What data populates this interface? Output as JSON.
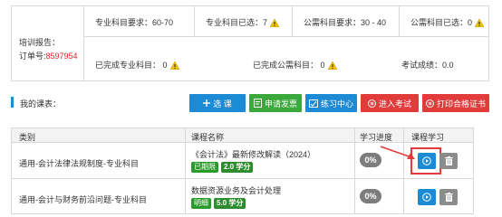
{
  "report": {
    "title": "培训报告：",
    "order_label": "订单号:",
    "order_number": "8597954",
    "professional_required": "专业科目要求：60-70",
    "professional_selected": "专业科目已选：7",
    "public_required": "公需科目要求：30 - 40",
    "public_selected": "公需科目已选：0",
    "professional_completed": "已完成专业科目： 0",
    "public_completed": "已完成公需科目： 0",
    "exam_score": "考试成绩：0.0"
  },
  "courses_section": {
    "label": "我的课表：",
    "buttons": {
      "select_course": "选 课",
      "apply_invoice": "申请发票",
      "practice_center": "练习中心",
      "enter_exam": "进入考试",
      "print_certificate": "打印合格证书"
    }
  },
  "table": {
    "headers": [
      "类别",
      "课程名称",
      "学习进度",
      "课程学习"
    ],
    "rows": [
      {
        "category": "通用-会计法律法规制度-专业科目",
        "course_name": "《会计法》最新修改解读（2024）",
        "tag": "已期限",
        "credit": "2.0 学分",
        "progress": "0%"
      },
      {
        "category": "通用-会计与财务前沿问题-专业科目",
        "course_name": "数据资源业务及会计处理",
        "tag": "明细",
        "credit": "5.0 学分",
        "progress": "0%"
      }
    ]
  },
  "colors": {
    "primary_blue": "#1d8ad6",
    "green": "#3aa83a",
    "red": "#e23b3b",
    "order_red": "#e8232a"
  }
}
